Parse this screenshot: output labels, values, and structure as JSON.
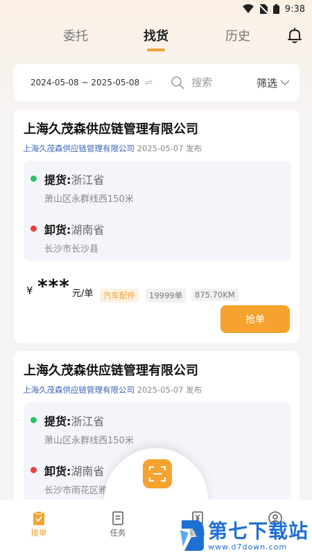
{
  "status_bar": {
    "time": "9:38"
  },
  "tabs": {
    "entrust": "委托",
    "find_goods": "找货",
    "history": "历史"
  },
  "search": {
    "date_range": "2024-05-08 ~ 2025-05-08",
    "swap_glyph": "⇌",
    "placeholder": "搜索",
    "filter_label": "筛选"
  },
  "orders": [
    {
      "company": "上海久茂森供应链管理有限公司",
      "publisher": "上海久茂森供应链管理有限公司",
      "published": "2025-05-07 发布",
      "pickup_label": "提货:",
      "pickup_province": "浙江省",
      "pickup_address": "萧山区永群线西150米",
      "unload_label": "卸货:",
      "unload_province": "湖南省",
      "unload_address": "长沙市长沙县",
      "currency": "¥",
      "price": "***",
      "price_unit": "元/单",
      "category": "汽车配件",
      "count": "19999单",
      "distance": "875.70KM",
      "action": "抢单"
    },
    {
      "company": "上海久茂森供应链管理有限公司",
      "publisher": "上海久茂森供应链管理有限公司",
      "published": "2025-05-07 发布",
      "pickup_label": "提货:",
      "pickup_province": "浙江省",
      "pickup_address": "萧山区永群线西150米",
      "unload_label": "卸货:",
      "unload_province": "湖南省",
      "unload_address": "长沙市雨花区雅"
    }
  ],
  "bottom_nav": {
    "orders": "接单",
    "tasks": "任务",
    "finance": "财务"
  },
  "watermark": {
    "title": "第七下载站",
    "url": "www.d7down.com"
  },
  "colors": {
    "accent": "#f6a22e",
    "link": "#3a63b8",
    "pickup_dot": "#27c26b",
    "unload_dot": "#ec3d3d",
    "watermark": "#1e6fd4"
  }
}
